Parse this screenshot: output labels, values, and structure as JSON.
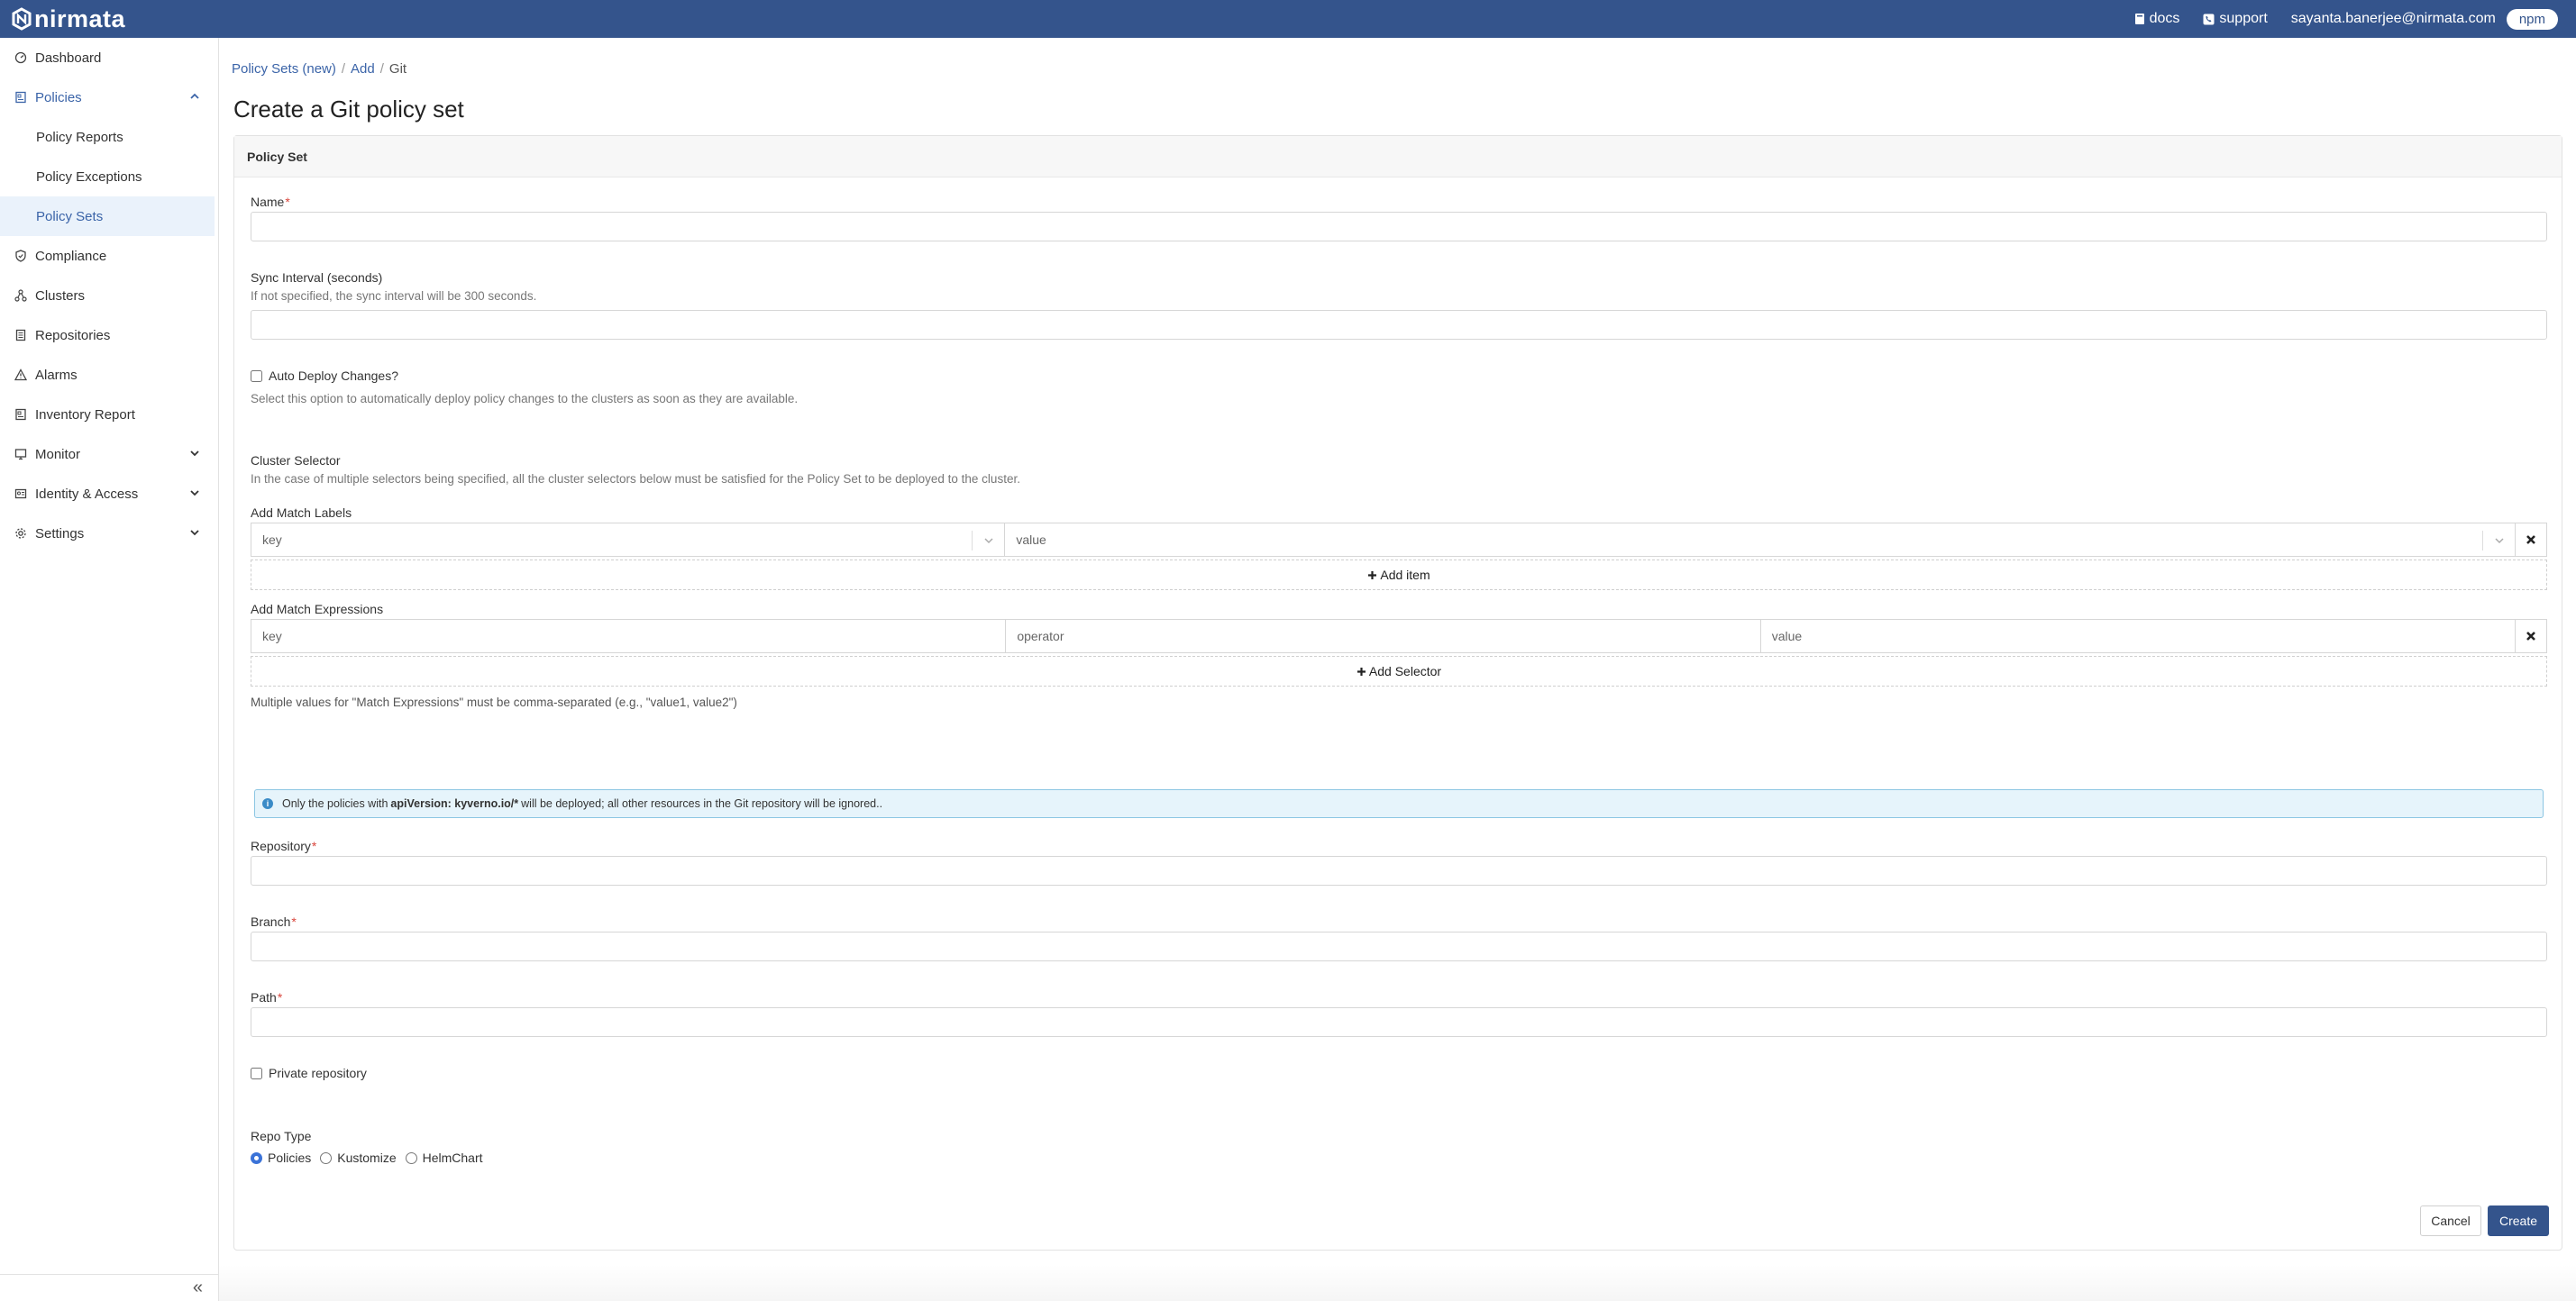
{
  "brand": {
    "name": "nirmata",
    "color": "#34548c"
  },
  "topbar": {
    "docs_label": "docs",
    "support_label": "support",
    "user_email": "sayanta.banerjee@nirmata.com",
    "org_label": "npm"
  },
  "sidebar": {
    "items": [
      {
        "label": "Dashboard",
        "icon": "dashboard-icon"
      },
      {
        "label": "Policies",
        "icon": "policies-icon",
        "expanded": true
      },
      {
        "label": "Policy Reports",
        "sub": true
      },
      {
        "label": "Policy Exceptions",
        "sub": true
      },
      {
        "label": "Policy Sets",
        "sub": true,
        "active": true
      },
      {
        "label": "Compliance",
        "icon": "shield-icon"
      },
      {
        "label": "Clusters",
        "icon": "clusters-icon"
      },
      {
        "label": "Repositories",
        "icon": "repositories-icon"
      },
      {
        "label": "Alarms",
        "icon": "alarm-icon"
      },
      {
        "label": "Inventory Report",
        "icon": "inventory-icon"
      },
      {
        "label": "Monitor",
        "icon": "monitor-icon"
      },
      {
        "label": "Identity & Access",
        "icon": "identity-icon"
      },
      {
        "label": "Settings",
        "icon": "gear-icon"
      }
    ],
    "collapse_label": "«"
  },
  "breadcrumb": {
    "items": [
      "Policy Sets (new)",
      "Add",
      "Git"
    ],
    "sep": "/"
  },
  "page": {
    "title": "Create a Git policy set",
    "card_header": "Policy Set"
  },
  "form": {
    "name_label": "Name",
    "required_mark": "*",
    "sync_label": "Sync Interval (seconds)",
    "sync_help": "If not specified, the sync interval will be 300 seconds.",
    "auto_deploy_label": "Auto Deploy Changes?",
    "auto_deploy_help": "Select this option to automatically deploy policy changes to the clusters as soon as they are available.",
    "cluster_selector_label": "Cluster Selector",
    "cluster_selector_help": "In the case of multiple selectors being specified, all the cluster selectors below must be satisfied for the Policy Set to be deployed to the cluster.",
    "match_labels_label": "Add Match Labels",
    "match_labels_key_placeholder": "key",
    "match_labels_value_placeholder": "value",
    "add_item_label": "Add item",
    "match_expr_label": "Add Match Expressions",
    "match_expr_key_placeholder": "key",
    "match_expr_operator_placeholder": "operator",
    "match_expr_value_placeholder": "value",
    "add_selector_label": "Add Selector",
    "match_expr_help": "Multiple values for \"Match Expressions\" must be comma-separated (e.g., \"value1, value2\")",
    "alert_prefix": "Only the policies with ",
    "alert_strong": "apiVersion: kyverno.io/*",
    "alert_suffix": " will be deployed; all other resources in the Git repository will be ignored..",
    "repository_label": "Repository",
    "branch_label": "Branch",
    "path_label": "Path",
    "private_repo_label": "Private repository",
    "repo_type_label": "Repo Type",
    "repo_types": [
      "Policies",
      "Kustomize",
      "HelmChart"
    ],
    "repo_type_selected": "Policies"
  },
  "actions": {
    "cancel_label": "Cancel",
    "create_label": "Create"
  }
}
